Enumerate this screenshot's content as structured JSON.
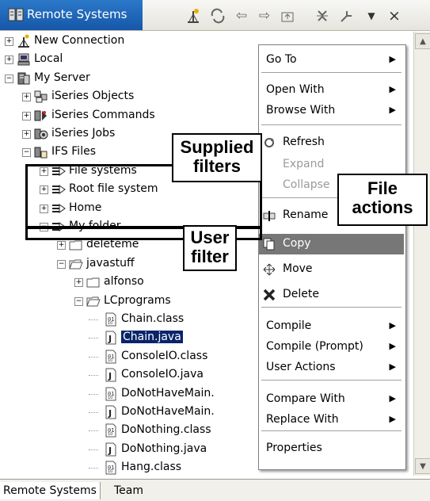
{
  "view": {
    "title": "Remote Systems",
    "toolbar_icons": [
      "new-connection-icon",
      "link-icon",
      "back-arrow-icon",
      "forward-arrow-icon",
      "up-folder-icon",
      "collapse-all-icon",
      "link-editor-icon",
      "view-menu-icon",
      "close-icon"
    ]
  },
  "tree": {
    "items": [
      {
        "label": "New Connection",
        "icon": "new-connection-icon",
        "expander": "+"
      },
      {
        "label": "Local",
        "icon": "computer-icon",
        "expander": "+"
      },
      {
        "label": "My Server",
        "icon": "server-icon",
        "expander": "−"
      },
      {
        "label": "iSeries Objects",
        "icon": "objects-icon",
        "expander": "+"
      },
      {
        "label": "iSeries Commands",
        "icon": "commands-icon",
        "expander": "+"
      },
      {
        "label": "iSeries Jobs",
        "icon": "jobs-icon",
        "expander": "+"
      },
      {
        "label": "IFS Files",
        "icon": "ifs-icon",
        "expander": "−"
      },
      {
        "label": "File systems",
        "icon": "filter-icon",
        "expander": "+"
      },
      {
        "label": "Root file system",
        "icon": "filter-icon",
        "expander": "+"
      },
      {
        "label": "Home",
        "icon": "filter-icon",
        "expander": "+"
      },
      {
        "label": "My folder",
        "icon": "filter-icon",
        "expander": "−"
      },
      {
        "label": "deleteme",
        "icon": "folder-icon",
        "expander": "+"
      },
      {
        "label": "javastuff",
        "icon": "open-folder-icon",
        "expander": "−"
      },
      {
        "label": "alfonso",
        "icon": "folder-icon",
        "expander": "+"
      },
      {
        "label": "LCprograms",
        "icon": "open-folder-icon",
        "expander": "−"
      },
      {
        "label": "Chain.class",
        "icon": "class-file-icon",
        "expander": ""
      },
      {
        "label": "Chain.java",
        "icon": "java-file-icon",
        "expander": ""
      },
      {
        "label": "ConsoleIO.class",
        "icon": "class-file-icon",
        "expander": ""
      },
      {
        "label": "ConsoleIO.java",
        "icon": "java-file-icon",
        "expander": ""
      },
      {
        "label": "DoNotHaveMain.",
        "icon": "class-file-icon",
        "expander": ""
      },
      {
        "label": "DoNotHaveMain.",
        "icon": "java-file-icon",
        "expander": ""
      },
      {
        "label": "DoNothing.class",
        "icon": "class-file-icon",
        "expander": ""
      },
      {
        "label": "DoNothing.java",
        "icon": "java-file-icon",
        "expander": ""
      },
      {
        "label": "Hang.class",
        "icon": "class-file-icon",
        "expander": ""
      }
    ]
  },
  "context_menu": {
    "items": [
      {
        "label": "Go To",
        "arrow": "▶"
      },
      {
        "label": "Open With",
        "arrow": "▶"
      },
      {
        "label": "Browse With",
        "arrow": "▶"
      },
      {
        "label": "Refresh",
        "icon": "refresh-icon"
      },
      {
        "label": "Expand"
      },
      {
        "label": "Collapse"
      },
      {
        "label": "Rename",
        "icon": "rename-icon"
      },
      {
        "label": "Copy",
        "icon": "copy-icon"
      },
      {
        "label": "Move",
        "icon": "move-icon"
      },
      {
        "label": "Delete",
        "icon": "delete-icon"
      },
      {
        "label": "Compile",
        "arrow": "▶"
      },
      {
        "label": "Compile (Prompt)",
        "arrow": "▶"
      },
      {
        "label": "User Actions",
        "arrow": "▶"
      },
      {
        "label": "Compare With",
        "arrow": "▶"
      },
      {
        "label": "Replace With",
        "arrow": "▶"
      },
      {
        "label": "Properties"
      }
    ]
  },
  "callouts": {
    "supplied_filters": [
      "Supplied",
      "filters"
    ],
    "user_filter": [
      "User",
      "filter"
    ],
    "file_actions": [
      "File",
      "actions"
    ]
  },
  "bottom_tabs": [
    "Remote Systems",
    "Team"
  ],
  "colors": {
    "title_tab": "#1f66b8",
    "selection": "#0a246a",
    "menu_highlight": "#777777"
  }
}
